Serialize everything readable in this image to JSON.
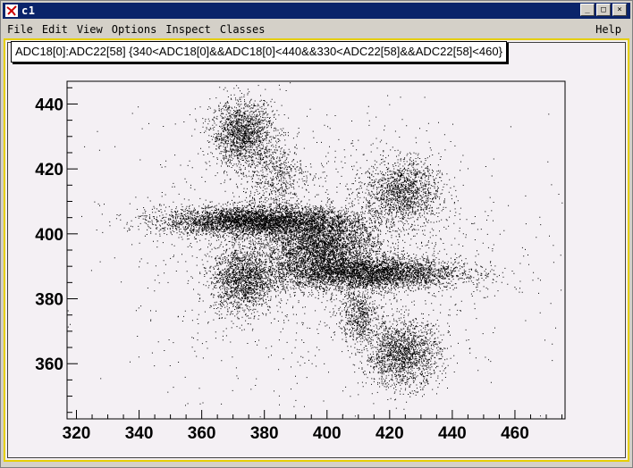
{
  "window": {
    "title": "c1",
    "buttons": [
      "_",
      "□",
      "×"
    ]
  },
  "menu": {
    "items": [
      "File",
      "Edit",
      "View",
      "Options",
      "Inspect",
      "Classes"
    ],
    "help": "Help"
  },
  "colors": {
    "titlebar": "#0a246a",
    "canvas_bg": "#f4f0f4",
    "frame_border": "#e6cf00",
    "marker": "#000000"
  },
  "chart_data": {
    "type": "scatter",
    "title": "ADC18[0]:ADC22[58] {340<ADC18[0]&&ADC18[0]<440&&330<ADC22[58]&&ADC22[58]<460}",
    "xlabel": "",
    "ylabel": "",
    "xlim": [
      317,
      476
    ],
    "ylim": [
      343,
      447
    ],
    "x_ticks": [
      320,
      340,
      360,
      380,
      400,
      420,
      440,
      460
    ],
    "y_ticks": [
      360,
      380,
      400,
      420,
      440
    ],
    "grid": false,
    "clusters": [
      {
        "name": "",
        "x_center": 373,
        "y_center": 431,
        "x_sd": 5,
        "y_sd": 5,
        "points": 1600
      },
      {
        "name": "",
        "x_center": 383,
        "y_center": 418,
        "x_sd": 5,
        "y_sd": 5,
        "points": 500
      },
      {
        "name": "",
        "x_center": 424,
        "y_center": 413,
        "x_sd": 6,
        "y_sd": 5,
        "points": 1400
      },
      {
        "name": "",
        "x_center": 373,
        "y_center": 386,
        "x_sd": 5,
        "y_sd": 5,
        "points": 1600
      },
      {
        "name": "",
        "x_center": 424,
        "y_center": 363,
        "x_sd": 6,
        "y_sd": 5,
        "points": 1700
      },
      {
        "name": "",
        "x_center": 410,
        "y_center": 375,
        "x_sd": 3,
        "y_sd": 4,
        "points": 500
      },
      {
        "name": "",
        "x_center": 378,
        "y_center": 404,
        "x_sd": 15,
        "y_sd": 2.3,
        "points": 4500
      },
      {
        "name": "",
        "x_center": 412,
        "y_center": 388,
        "x_sd": 15,
        "y_sd": 2.5,
        "points": 4000
      },
      {
        "name": "",
        "x_center": 398,
        "y_center": 396,
        "x_sd": 9,
        "y_sd": 4.5,
        "points": 3200
      },
      {
        "name": "",
        "x_center": 400,
        "y_center": 395,
        "x_sd": 30,
        "y_sd": 20,
        "points": 1800
      }
    ]
  }
}
